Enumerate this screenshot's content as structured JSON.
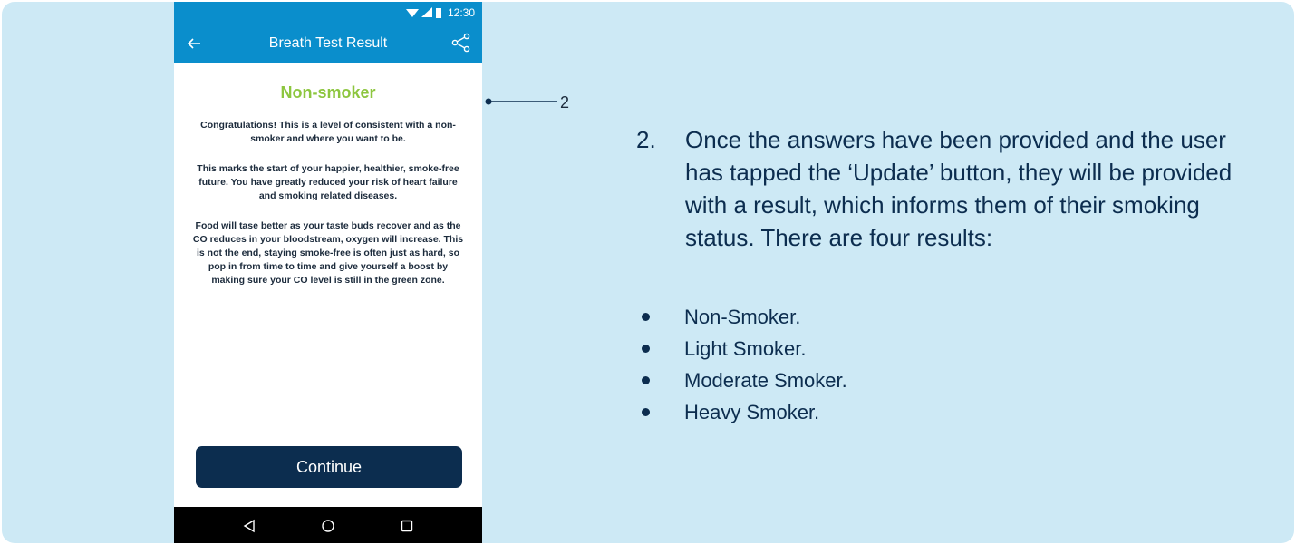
{
  "status_bar": {
    "time": "12:30"
  },
  "app_bar": {
    "title": "Breath Test Result"
  },
  "result": {
    "title": "Non-smoker",
    "paragraph1": "Congratulations! This is a level of consistent with a non-smoker and where you want to be.",
    "paragraph2": "This marks the start of your happier, healthier, smoke-free future. You have greatly reduced your risk of heart failure and smoking related diseases.",
    "paragraph3": "Food will tase better as your taste buds recover and as the CO reduces in your bloodstream, oxygen will increase. This is not the end, staying smoke-free is often just as hard, so pop in from time to time and give yourself a boost by making sure your CO level is still in the green zone."
  },
  "continue_label": "Continue",
  "callout_number": "2",
  "description": {
    "number": "2.",
    "text": "Once the answers have been provided and the user has tapped the ‘Update’ button, they will be provided with a result, which informs them of their smoking status. There are four results:"
  },
  "bullets": [
    "Non-Smoker.",
    "Light Smoker.",
    "Moderate Smoker.",
    "Heavy Smoker."
  ],
  "colors": {
    "background": "#cde9f5",
    "app_bar": "#0a8ecc",
    "result_title": "#8dc63f",
    "button": "#0c2d4f",
    "text": "#0c2d4f"
  }
}
